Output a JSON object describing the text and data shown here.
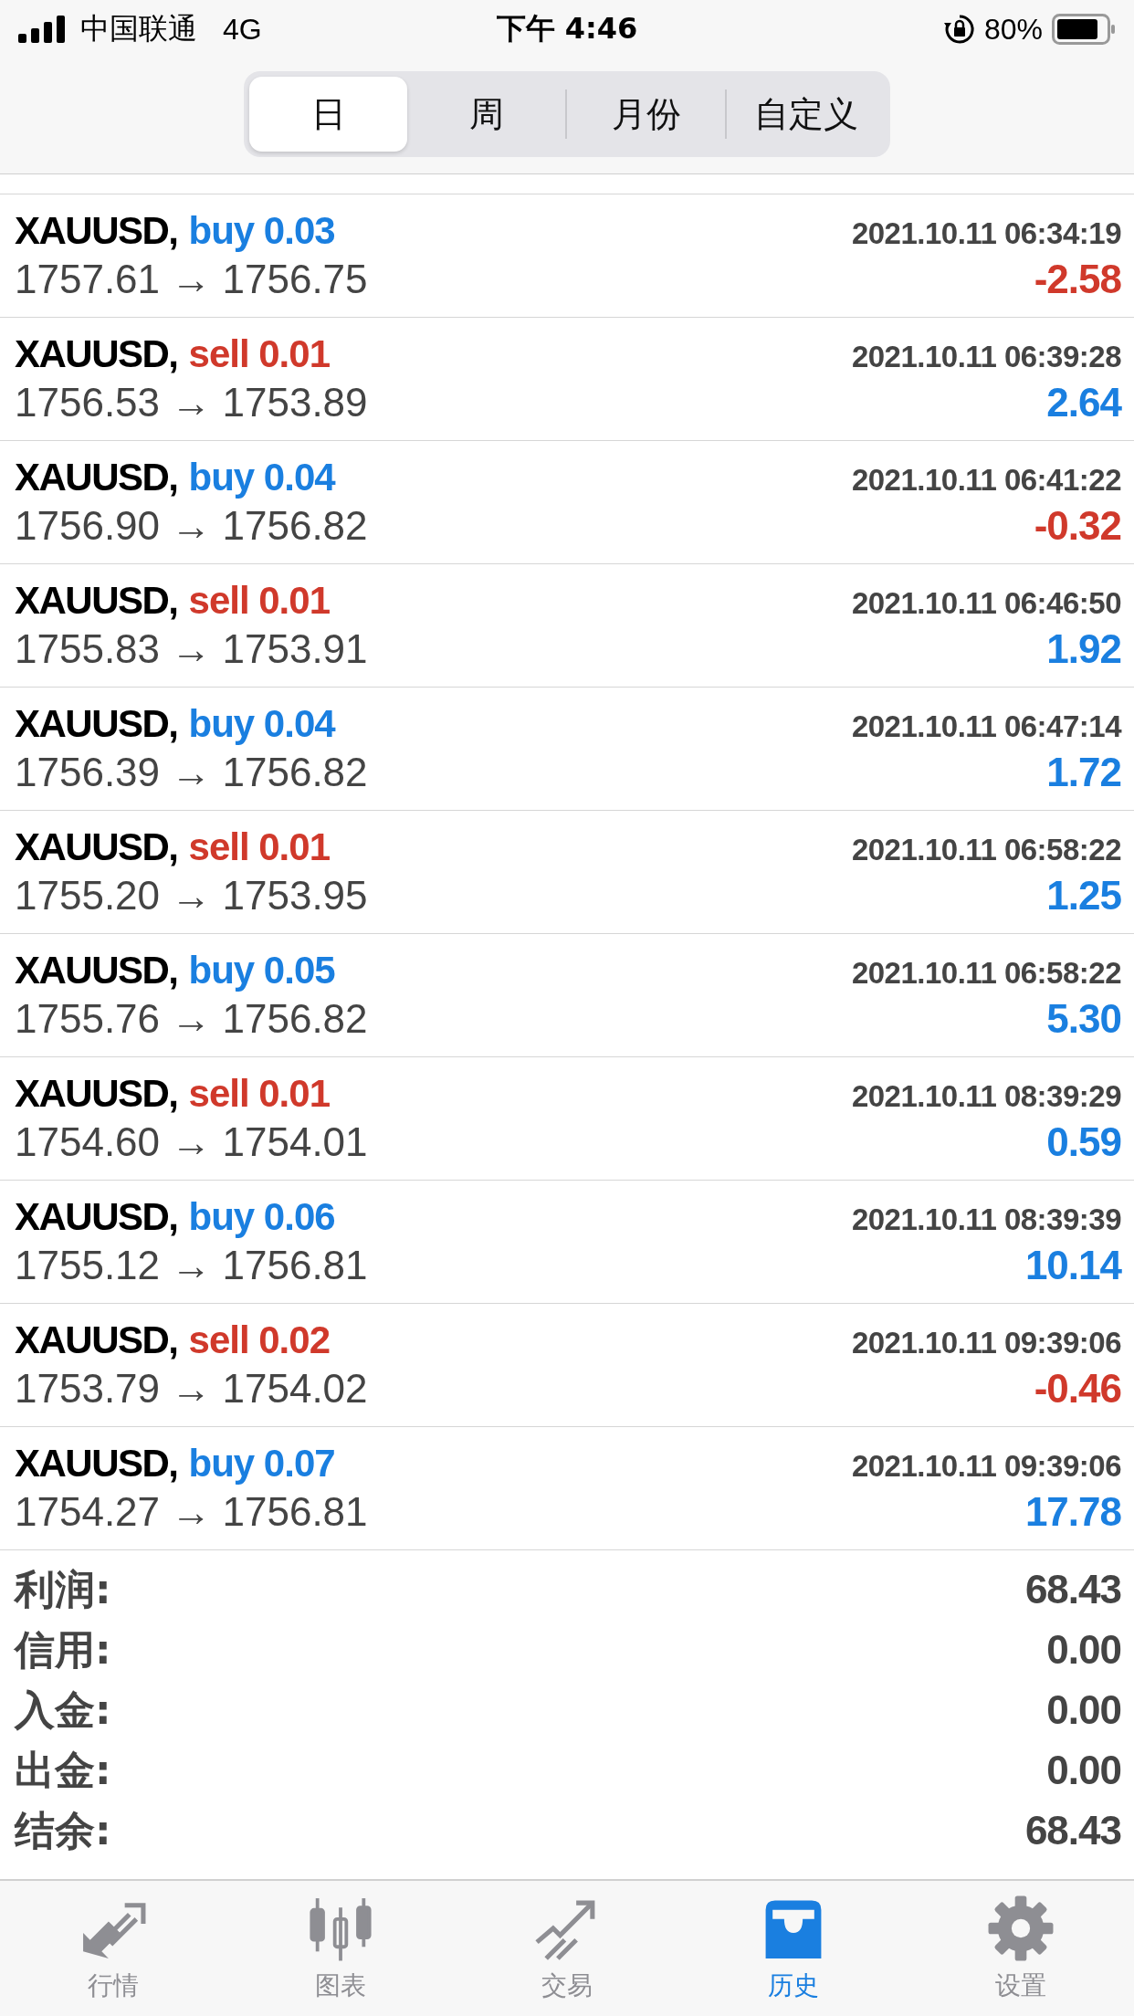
{
  "status_bar": {
    "carrier": "中国联通",
    "network": "4G",
    "time": "下午 4:46",
    "battery": "80%"
  },
  "period_tabs": [
    {
      "label": "日",
      "selected": true
    },
    {
      "label": "周",
      "selected": false
    },
    {
      "label": "月份",
      "selected": false
    },
    {
      "label": "自定义",
      "selected": false
    }
  ],
  "deals": [
    {
      "symbol": "XAUUSD,",
      "order": {
        "text": "buy 0.03",
        "color": "#1a7fe0"
      },
      "time": "2021.10.11 06:34:19",
      "prices": "1757.61 → 1756.75",
      "profit": {
        "text": "-2.58",
        "color": "#d0392b"
      }
    },
    {
      "symbol": "XAUUSD,",
      "order": {
        "text": "sell 0.01",
        "color": "#d0392b"
      },
      "time": "2021.10.11 06:39:28",
      "prices": "1756.53 → 1753.89",
      "profit": {
        "text": "2.64",
        "color": "#1a7fe0"
      }
    },
    {
      "symbol": "XAUUSD,",
      "order": {
        "text": "buy 0.04",
        "color": "#1a7fe0"
      },
      "time": "2021.10.11 06:41:22",
      "prices": "1756.90 → 1756.82",
      "profit": {
        "text": "-0.32",
        "color": "#d0392b"
      }
    },
    {
      "symbol": "XAUUSD,",
      "order": {
        "text": "sell 0.01",
        "color": "#d0392b"
      },
      "time": "2021.10.11 06:46:50",
      "prices": "1755.83 → 1753.91",
      "profit": {
        "text": "1.92",
        "color": "#1a7fe0"
      }
    },
    {
      "symbol": "XAUUSD,",
      "order": {
        "text": "buy 0.04",
        "color": "#1a7fe0"
      },
      "time": "2021.10.11 06:47:14",
      "prices": "1756.39 → 1756.82",
      "profit": {
        "text": "1.72",
        "color": "#1a7fe0"
      }
    },
    {
      "symbol": "XAUUSD,",
      "order": {
        "text": "sell 0.01",
        "color": "#d0392b"
      },
      "time": "2021.10.11 06:58:22",
      "prices": "1755.20 → 1753.95",
      "profit": {
        "text": "1.25",
        "color": "#1a7fe0"
      }
    },
    {
      "symbol": "XAUUSD,",
      "order": {
        "text": "buy 0.05",
        "color": "#1a7fe0"
      },
      "time": "2021.10.11 06:58:22",
      "prices": "1755.76 → 1756.82",
      "profit": {
        "text": "5.30",
        "color": "#1a7fe0"
      }
    },
    {
      "symbol": "XAUUSD,",
      "order": {
        "text": "sell 0.01",
        "color": "#d0392b"
      },
      "time": "2021.10.11 08:39:29",
      "prices": "1754.60 → 1754.01",
      "profit": {
        "text": "0.59",
        "color": "#1a7fe0"
      }
    },
    {
      "symbol": "XAUUSD,",
      "order": {
        "text": "buy 0.06",
        "color": "#1a7fe0"
      },
      "time": "2021.10.11 08:39:39",
      "prices": "1755.12 → 1756.81",
      "profit": {
        "text": "10.14",
        "color": "#1a7fe0"
      }
    },
    {
      "symbol": "XAUUSD,",
      "order": {
        "text": "sell 0.02",
        "color": "#d0392b"
      },
      "time": "2021.10.11 09:39:06",
      "prices": "1753.79 → 1754.02",
      "profit": {
        "text": "-0.46",
        "color": "#d0392b"
      }
    },
    {
      "symbol": "XAUUSD,",
      "order": {
        "text": "buy 0.07",
        "color": "#1a7fe0"
      },
      "time": "2021.10.11 09:39:06",
      "prices": "1754.27 → 1756.81",
      "profit": {
        "text": "17.78",
        "color": "#1a7fe0"
      }
    }
  ],
  "summary": [
    {
      "label": "利润:",
      "value": "68.43"
    },
    {
      "label": "信用:",
      "value": "0.00"
    },
    {
      "label": "入金:",
      "value": "0.00"
    },
    {
      "label": "出金:",
      "value": "0.00"
    },
    {
      "label": "结余:",
      "value": "68.43"
    }
  ],
  "tab_bar": [
    {
      "kind": "quotes",
      "label": "行情",
      "selected": false
    },
    {
      "kind": "chart",
      "label": "图表",
      "selected": false
    },
    {
      "kind": "trade",
      "label": "交易",
      "selected": false
    },
    {
      "kind": "history",
      "label": "历史",
      "selected": true
    },
    {
      "kind": "settings",
      "label": "设置",
      "selected": false
    }
  ]
}
